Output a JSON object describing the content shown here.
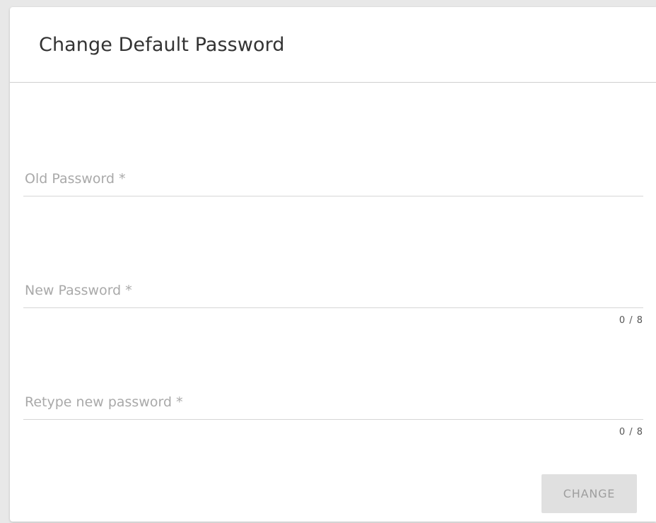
{
  "dialog": {
    "title": "Change Default Password"
  },
  "fields": {
    "old_password": {
      "placeholder": "Old Password *",
      "value": ""
    },
    "new_password": {
      "placeholder": "New Password *",
      "value": "",
      "counter": "0 / 8"
    },
    "retype_password": {
      "placeholder": "Retype new password *",
      "value": "",
      "counter": "0 / 8"
    }
  },
  "actions": {
    "change_label": "CHANGE"
  },
  "colors": {
    "background": "#e8e8e8",
    "card": "#ffffff",
    "placeholder": "#a9a9a9",
    "button_disabled_bg": "#e0e0e0",
    "button_disabled_text": "#9e9e9e"
  }
}
